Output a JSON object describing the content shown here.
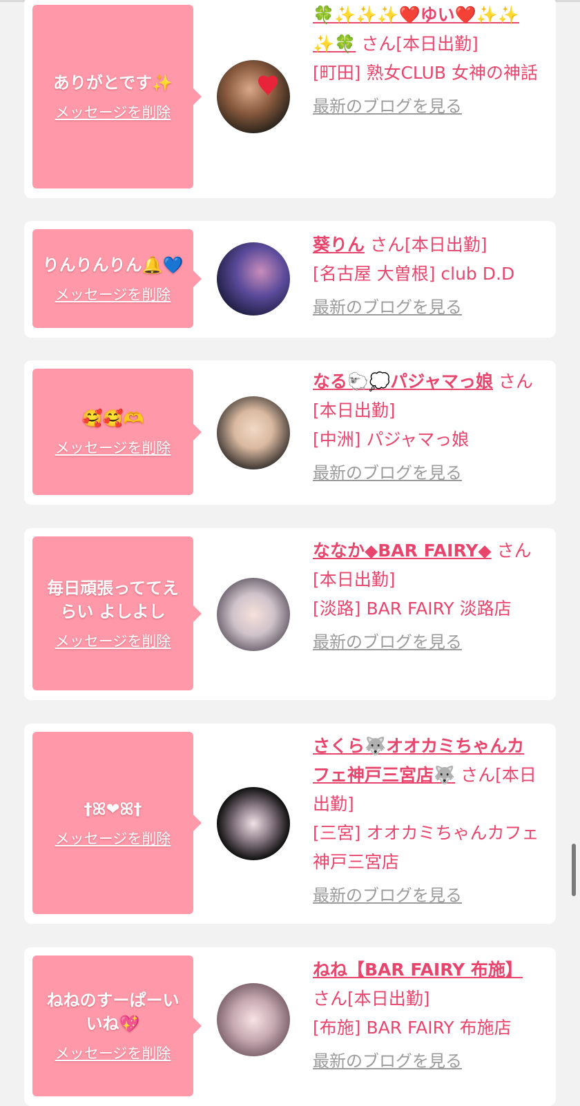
{
  "cards": [
    {
      "message": "ありがとです✨",
      "delete_label": "メッセージを削除",
      "name": "🍀✨✨✨❤️ゆい❤️✨✨✨🍀",
      "san": " さん",
      "status": "[本日出勤]",
      "shop": "[町田] 熟女CLUB 女神の神話",
      "blog_label": "最新のブログを見る",
      "avatar_icon": "heart-avatar-photo"
    },
    {
      "message": "りんりんりん🔔💙",
      "delete_label": "メッセージを削除",
      "name": "葵りん",
      "san": " さん",
      "status": "[本日出勤]",
      "shop": "[名古屋 大曽根] club D.D",
      "blog_label": "最新のブログを見る",
      "avatar_icon": "profile-photo"
    },
    {
      "message": "🥰🥰🫶",
      "delete_label": "メッセージを削除",
      "name": "なる🐑💭パジャマっ娘",
      "san": " さん",
      "status": "[本日出勤]",
      "shop": "[中洲] パジャマっ娘",
      "blog_label": "最新のブログを見る",
      "avatar_icon": "profile-photo"
    },
    {
      "message": "毎日頑張っててえらい よしよし",
      "delete_label": "メッセージを削除",
      "name": "ななか◆BAR FAIRY◆",
      "san": " さん",
      "status": "[本日出勤]",
      "shop": "[淡路] BAR FAIRY 淡路店",
      "blog_label": "最新のブログを見る",
      "avatar_icon": "profile-photo"
    },
    {
      "message": "†ꕤ❤︎ꕤ†",
      "delete_label": "メッセージを削除",
      "name": "さくら🐺オオカミちゃんカフェ神戸三宮店🐺",
      "san": " さん",
      "status": "[本日出勤]",
      "shop": "[三宮] オオカミちゃんカフェ神戸三宮店",
      "blog_label": "最新のブログを見る",
      "avatar_icon": "profile-photo"
    },
    {
      "message": "ねねのすーぱーいいね💖",
      "delete_label": "メッセージを削除",
      "name": "ねね【BAR FAIRY 布施】",
      "san": " さん",
      "status": "[本日出勤]",
      "shop": "[布施] BAR FAIRY 布施店",
      "blog_label": "最新のブログを見る",
      "avatar_icon": "profile-photo"
    }
  ],
  "colors": {
    "background": "#f2f2f2",
    "card": "#ffffff",
    "bubble": "#ff98a8",
    "accent_text": "#e8456d",
    "link_gray": "#9b9b9b"
  }
}
